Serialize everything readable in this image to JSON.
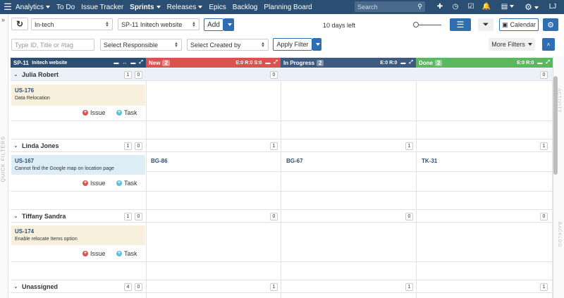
{
  "nav": {
    "items": [
      {
        "label": "Analytics",
        "caret": true
      },
      {
        "label": "To Do",
        "caret": false
      },
      {
        "label": "Issue Tracker",
        "caret": false
      },
      {
        "label": "Sprints",
        "caret": true
      },
      {
        "label": "Releases",
        "caret": true
      },
      {
        "label": "Epics",
        "caret": false
      },
      {
        "label": "Backlog",
        "caret": false
      },
      {
        "label": "Planning Board",
        "caret": false
      }
    ],
    "search_placeholder": "Search",
    "user_initials": "LJ"
  },
  "toolbar": {
    "project": "In-tech",
    "sprint": "SP-11 Initech website",
    "add_label": "Add",
    "days_left": "10 days left",
    "calendar_label": "Calendar"
  },
  "filters": {
    "search_placeholder": "Type ID, Title or #tag",
    "responsible": "Select Responsible",
    "created_by": "Select Created by",
    "apply_label": "Apply Filter",
    "more_label": "More Filters"
  },
  "sidebar_left_label": "QUICK FILTERS",
  "sidebar_right_labels": [
    "ACTIVITY",
    "BACKLOG"
  ],
  "colors": {
    "nav": "#2b4f73",
    "col_sprint": "#2b4f73",
    "col_new": "#d9534f",
    "col_progress": "#3d5a80",
    "col_done": "#5cb85c",
    "card_yellow": "#f7f0dc",
    "card_blue": "#dcedf6",
    "accent": "#2e6fb3"
  },
  "columns": [
    {
      "title": "SP-11",
      "subtitle": "Initech website"
    },
    {
      "title": "New",
      "count": "2",
      "stats": "E:0  R:0  S:0"
    },
    {
      "title": "In Progress",
      "count": "2",
      "stats": "E:0  R:0"
    },
    {
      "title": "Done",
      "count": "2",
      "stats": "E:0  R:0"
    }
  ],
  "lanes": [
    {
      "name": "Julia Robert",
      "c1": "1",
      "c2": "0",
      "new": "0",
      "progress": "",
      "done": "0",
      "card": {
        "id": "US-176",
        "title": "Data Relocation",
        "color": "yellow"
      },
      "cells": {
        "new": "",
        "progress": "",
        "done": ""
      }
    },
    {
      "name": "Linda Jones",
      "c1": "1",
      "c2": "0",
      "new": "1",
      "progress": "1",
      "done": "1",
      "card": {
        "id": "US-167",
        "title": "Cannot find the Google map on location page",
        "color": "blue"
      },
      "cells": {
        "new": "BG-86",
        "progress": "BG-67",
        "done": "TK-31"
      }
    },
    {
      "name": "Tiffany Sandra",
      "c1": "1",
      "c2": "0",
      "new": "0",
      "progress": "0",
      "done": "0",
      "card": {
        "id": "US-174",
        "title": "Enable relocate Items option",
        "color": "yellow"
      },
      "cells": {
        "new": "",
        "progress": "",
        "done": ""
      }
    },
    {
      "name": "Unassigned",
      "c1": "4",
      "c2": "0",
      "new": "1",
      "progress": "1",
      "done": "1",
      "card": null,
      "cells": {
        "new": "",
        "progress": "",
        "done": ""
      }
    }
  ],
  "card_actions": {
    "issue": "Issue",
    "task": "Task"
  }
}
